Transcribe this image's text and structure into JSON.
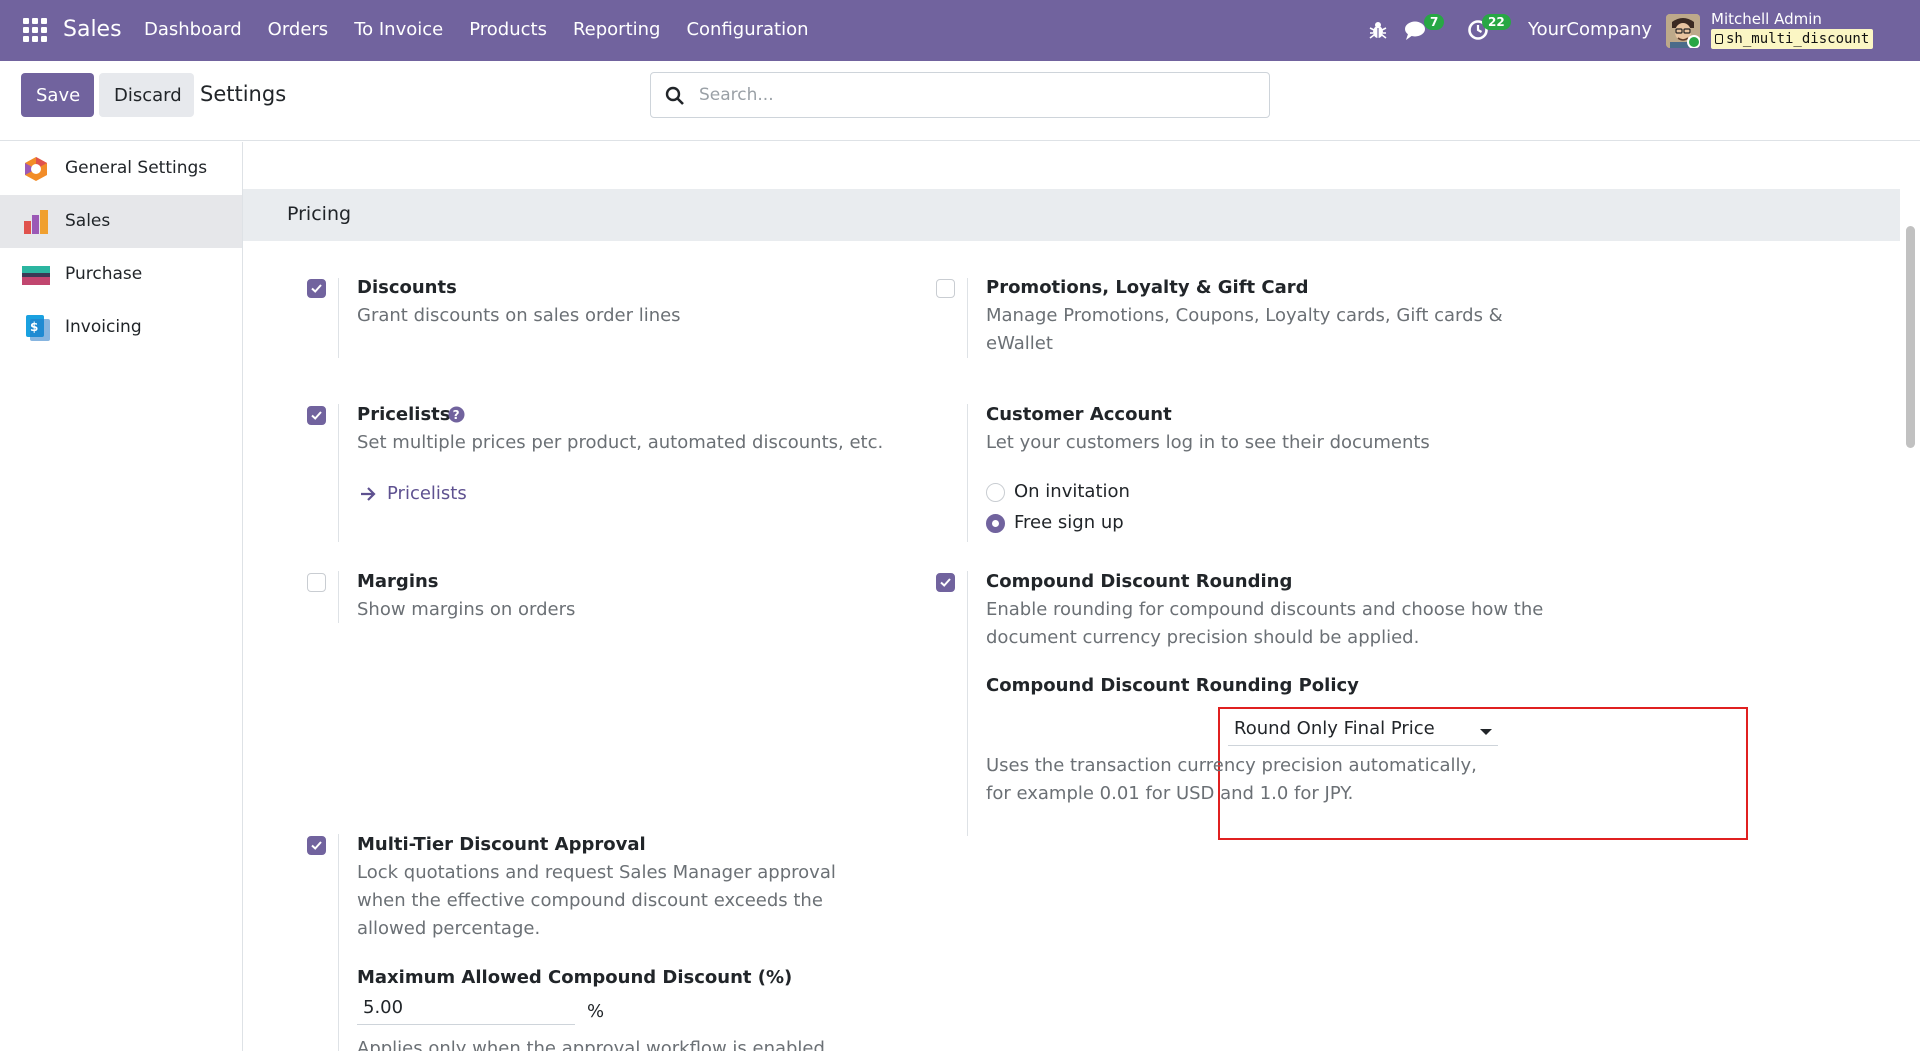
{
  "navbar": {
    "app_name": "Sales",
    "menu": [
      "Dashboard",
      "Orders",
      "To Invoice",
      "Products",
      "Reporting",
      "Configuration"
    ],
    "chat_count": "7",
    "activity_count": "22",
    "company": "YourCompany",
    "user_name": "Mitchell Admin",
    "database": "sh_multi_discount",
    "accent_color": "#71639e"
  },
  "control": {
    "save_label": "Save",
    "discard_label": "Discard",
    "breadcrumb": "Settings",
    "search_placeholder": "Search..."
  },
  "sidebar": {
    "items": [
      {
        "label": "General Settings",
        "icon": "odoo-settings-icon"
      },
      {
        "label": "Sales",
        "icon": "sales-chart-icon",
        "active": true
      },
      {
        "label": "Purchase",
        "icon": "purchase-card-icon"
      },
      {
        "label": "Invoicing",
        "icon": "invoicing-icon"
      }
    ]
  },
  "section": {
    "title": "Pricing",
    "settings": {
      "discounts": {
        "title": "Discounts",
        "desc": "Grant discounts on sales order lines",
        "checked": true
      },
      "promotions": {
        "title": "Promotions, Loyalty & Gift Card",
        "desc": "Manage Promotions, Coupons, Loyalty cards, Gift cards & eWallet",
        "checked": false
      },
      "pricelists": {
        "title": "Pricelists",
        "desc": "Set multiple prices per product, automated discounts, etc.",
        "link": "Pricelists",
        "checked": true
      },
      "customer_account": {
        "title": "Customer Account",
        "desc": "Let your customers log in to see their documents",
        "option1": "On invitation",
        "option2": "Free sign up",
        "selected": "Free sign up"
      },
      "margins": {
        "title": "Margins",
        "desc": "Show margins on orders",
        "checked": false
      },
      "rounding": {
        "title": "Compound Discount Rounding",
        "desc": "Enable rounding for compound discounts and choose how the document currency precision should be applied.",
        "checked": true,
        "policy_label": "Compound Discount Rounding Policy",
        "policy_value": "Round Only Final Price",
        "policy_help": "Uses the transaction currency precision automatically, for example 0.01 for USD and 1.0 for JPY."
      },
      "approval": {
        "title": "Multi-Tier Discount Approval",
        "desc": "Lock quotations and request Sales Manager approval when the effective compound discount exceeds the allowed percentage.",
        "checked": true,
        "max_label": "Maximum Allowed Compound Discount (%)",
        "max_value": "5.00",
        "unit": "%",
        "note": "Applies only when the approval workflow is enabled."
      }
    }
  }
}
